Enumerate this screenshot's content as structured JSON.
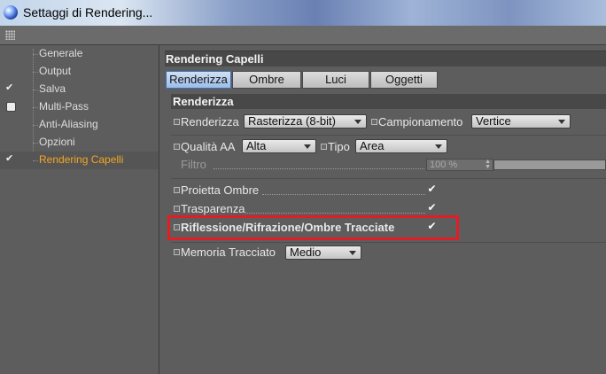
{
  "window": {
    "title": "Settaggi di Rendering..."
  },
  "sidebar": {
    "items": [
      {
        "label": "Generale",
        "check": ""
      },
      {
        "label": "Output",
        "check": ""
      },
      {
        "label": "Salva",
        "check": "✔"
      },
      {
        "label": "Multi-Pass",
        "check": "box"
      },
      {
        "label": "Anti-Aliasing",
        "check": ""
      },
      {
        "label": "Opzioni",
        "check": ""
      },
      {
        "label": "Rendering Capelli",
        "check": "✔"
      }
    ]
  },
  "main": {
    "section_title": "Rendering Capelli",
    "tabs": [
      "Renderizza",
      "Ombre",
      "Luci",
      "Oggetti"
    ],
    "active_tab": "Renderizza",
    "subsection_title": "Renderizza",
    "fields": {
      "renderizza": {
        "label": "Renderizza",
        "value": "Rasterizza (8-bit)"
      },
      "campionamento": {
        "label": "Campionamento",
        "value": "Vertice"
      },
      "qualita": {
        "label": "Qualità AA",
        "value": "Alta"
      },
      "tipo": {
        "label": "Tipo",
        "value": "Area"
      },
      "filtro": {
        "label": "Filtro",
        "value": "100 %"
      },
      "proietta_ombre": {
        "label": "Proietta Ombre",
        "checked": true
      },
      "trasparenza": {
        "label": "Trasparenza",
        "checked": true
      },
      "riflessione": {
        "label": "Riflessione/Rifrazione/Ombre Tracciate",
        "checked": true
      },
      "memoria": {
        "label": "Memoria Tracciato",
        "value": "Medio"
      }
    },
    "check_glyph": "✔"
  },
  "colors": {
    "highlight": "#e01e24",
    "active_nav": "#f2a623",
    "active_tab": "#9dbde8"
  }
}
